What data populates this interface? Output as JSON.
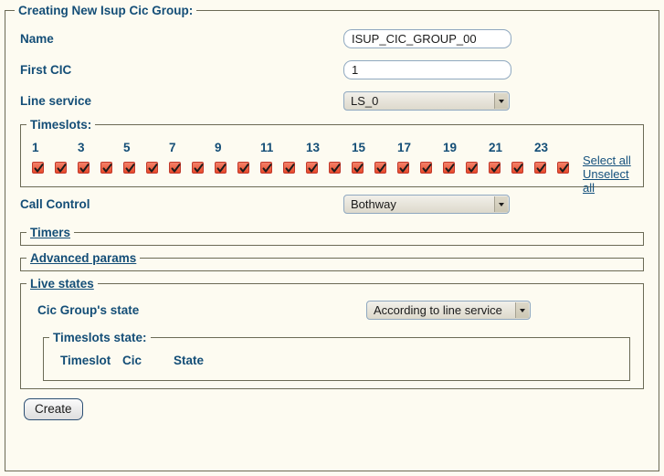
{
  "form": {
    "legend": "Creating New Isup Cic Group:",
    "fields": {
      "name_label": "Name",
      "name_value": "ISUP_CIC_GROUP_00",
      "first_cic_label": "First CIC",
      "first_cic_value": "1",
      "line_service_label": "Line service",
      "line_service_value": "LS_0",
      "call_control_label": "Call Control",
      "call_control_value": "Bothway"
    }
  },
  "timeslots": {
    "legend": "Timeslots:",
    "numbers": [
      "1",
      "3",
      "5",
      "7",
      "9",
      "11",
      "13",
      "15",
      "17",
      "19",
      "21",
      "23"
    ],
    "count": 24,
    "checked": [
      true,
      true,
      true,
      true,
      true,
      true,
      true,
      true,
      true,
      true,
      true,
      true,
      true,
      true,
      true,
      true,
      true,
      true,
      true,
      true,
      true,
      true,
      true,
      true
    ],
    "select_all_label": "Select all",
    "unselect_all_label": "Unselect all"
  },
  "sections": {
    "timers_label": "Timers",
    "advanced_params_label": "Advanced params",
    "live_states_label": "Live states"
  },
  "live_states": {
    "cic_group_state_label": "Cic Group's state",
    "cic_group_state_value": "According to line service",
    "timeslots_state_legend": "Timeslots state:",
    "table_headers": [
      "Timeslot",
      "Cic",
      "State"
    ],
    "table_rows": []
  },
  "actions": {
    "create_label": "Create"
  },
  "colors": {
    "page_background": "#fdfbf1",
    "label_text": "#144e77",
    "border": "#6b6a55",
    "checkbox_fill": "#ef6a4e",
    "link_text": "#15517d"
  }
}
